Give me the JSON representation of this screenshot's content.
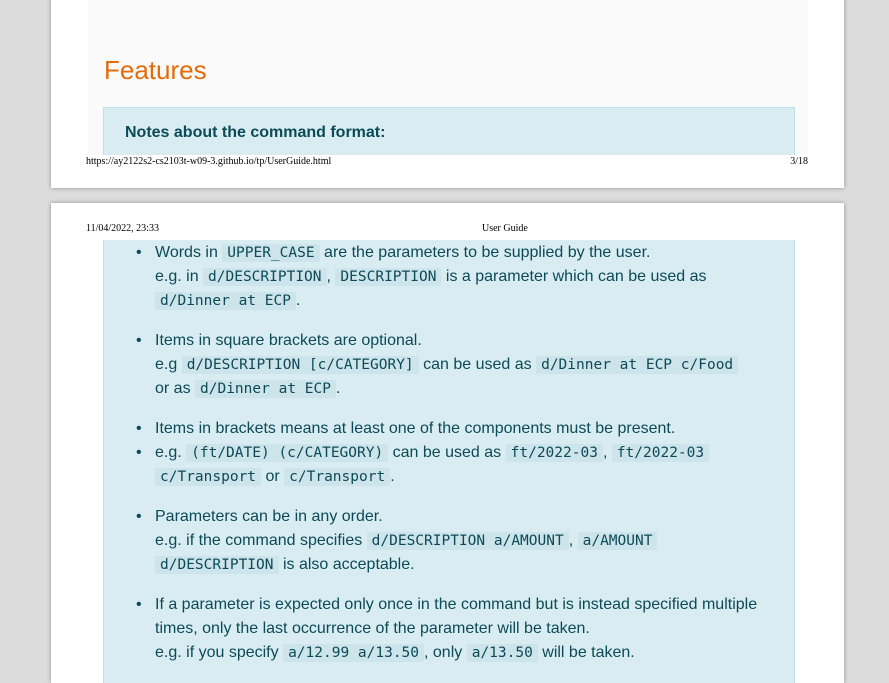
{
  "page1": {
    "heading": "Features",
    "note_heading": "Notes about the command format:",
    "footer_url": "https://ay2122s2-cs2103t-w09-3.github.io/tp/UserGuide.html",
    "footer_page": "3/18"
  },
  "page2": {
    "header_date": "11/04/2022, 23:33",
    "header_title": "User Guide",
    "notes": [
      {
        "t1": "Words in ",
        "c1": "UPPER_CASE",
        "t2": " are the parameters to be supplied by the user.",
        "t3": "e.g. in ",
        "c2": "d/DESCRIPTION",
        "t4": ", ",
        "c3": "DESCRIPTION",
        "t5": " is a parameter which can be used as",
        "c4": "d/Dinner at ECP",
        "t6": "."
      },
      {
        "t1": "Items in square brackets are optional.",
        "t2": "e.g ",
        "c1": "d/DESCRIPTION [c/CATEGORY]",
        "t3": " can be used as ",
        "c2": "d/Dinner at ECP c/Food",
        "t4": "or as ",
        "c3": "d/Dinner at ECP",
        "t5": "."
      },
      {
        "t1": "Items in brackets means at least one of the components must be present."
      },
      {
        "t1": "e.g. ",
        "c1": "(ft/DATE) (c/CATEGORY)",
        "t2": " can be used as ",
        "c2": "ft/2022-03",
        "t3": ", ",
        "c3": "ft/2022-03",
        "c4": "c/Transport",
        "t4": " or ",
        "c5": "c/Transport",
        "t5": "."
      },
      {
        "t1": "Parameters can be in any order.",
        "t2": "e.g. if the command specifies ",
        "c1": "d/DESCRIPTION a/AMOUNT",
        "t3": ", ",
        "c2": "a/AMOUNT",
        "c3": "d/DESCRIPTION",
        "t4": " is also acceptable."
      },
      {
        "t1": "If a parameter is expected only once in the command but is instead specified multiple times, only the last occurrence of the parameter will be taken.",
        "t2": "e.g. if you specify ",
        "c1": "a/12.99 a/13.50",
        "t3": ", only ",
        "c2": "a/13.50",
        "t4": " will be taken."
      }
    ]
  }
}
